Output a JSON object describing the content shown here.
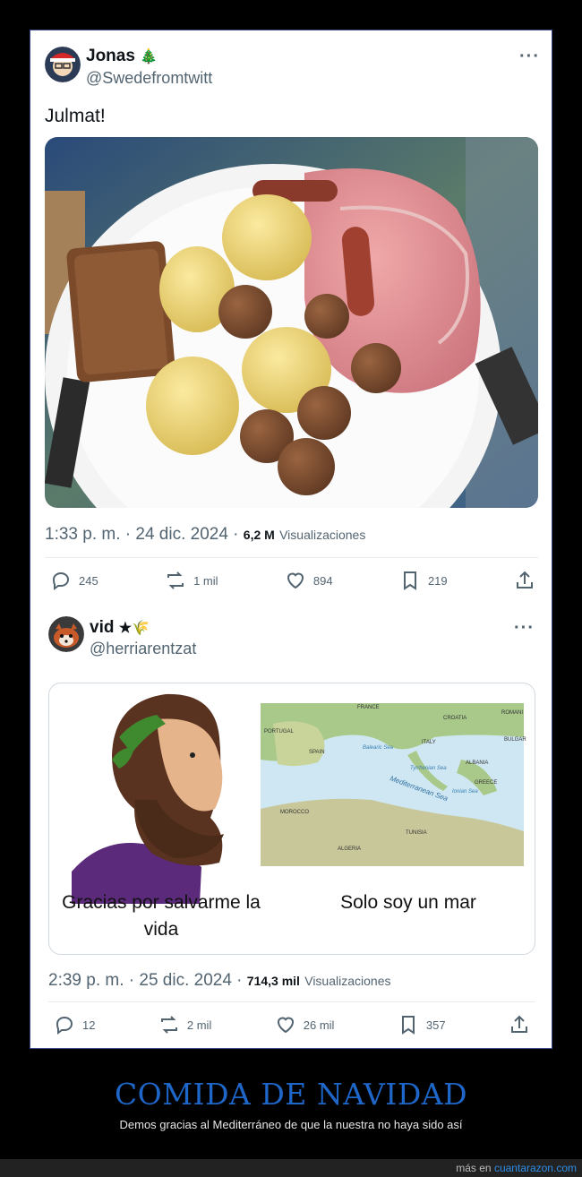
{
  "tweets": [
    {
      "author": "Jonas",
      "emoji": "🎄",
      "handle": "@Swedefromtwitt",
      "text": "Julmat!",
      "time": "1:33 p. m. · 24 dic. 2024 · ",
      "views": "6,2 M",
      "views_label": "Visualizaciones",
      "actions": {
        "replies": "245",
        "reposts": "1 mil",
        "likes": "894",
        "bookmarks": "219"
      }
    },
    {
      "author": "vid",
      "emoji": "★🌾",
      "handle": "@herriarentzat",
      "time": "2:39 p. m. · 25 dic. 2024 · ",
      "views": "714,3 mil",
      "views_label": "Visualizaciones",
      "meme": {
        "left_caption": "Gracias por salvarme la vida",
        "right_caption": "Solo soy un mar",
        "map_labels": [
          "FRANCE",
          "PORTUGAL",
          "SPAIN",
          "ITALY",
          "Balearic Sea",
          "Tyrrhenian Sea",
          "Ionian Sea",
          "GREECE",
          "MOROCCO",
          "ALGERIA",
          "TUNISIA",
          "Mediterranean Sea",
          "ROMANI",
          "BULGAR",
          "CROATIA",
          "ALBANIA"
        ]
      },
      "actions": {
        "replies": "12",
        "reposts": "2 mil",
        "likes": "26 mil",
        "bookmarks": "357"
      }
    }
  ],
  "footer": {
    "title": "COMIDA DE NAVIDAD",
    "subtitle": "Demos gracias al Mediterráneo de que la nuestra no haya sido así",
    "source_prefix": "más en ",
    "source_link": "cuantarazon.com"
  },
  "colors": {
    "accent": "#1e66c8",
    "link": "#2f8de4",
    "text_muted": "#536471"
  }
}
